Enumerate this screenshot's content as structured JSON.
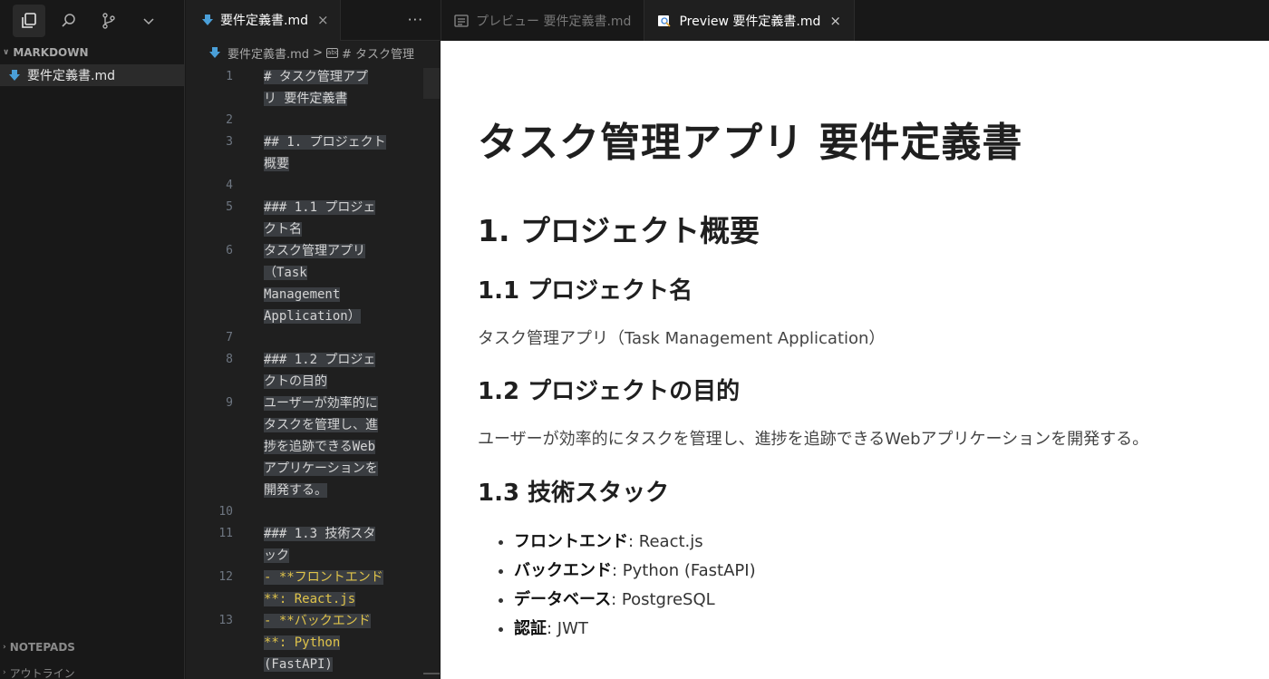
{
  "sidebar": {
    "section_title": "MARKDOWN",
    "file_name": "要件定義書.md",
    "notepads_label": "NOTEPADS",
    "outline_label": "アウトライン"
  },
  "editor": {
    "tab_label": "要件定義書.md",
    "close_glyph": "×",
    "more_glyph": "···",
    "breadcrumb_file": "要件定義書.md",
    "breadcrumb_sep": ">",
    "breadcrumb_icon": "abc",
    "breadcrumb_symbol": "# タスク管理",
    "lines": [
      {
        "n": "1",
        "rows": [
          "# タスク管理アプ",
          "リ 要件定義書"
        ]
      },
      {
        "n": "2",
        "rows": [
          ""
        ]
      },
      {
        "n": "3",
        "rows": [
          "## 1. プロジェクト",
          "概要"
        ]
      },
      {
        "n": "4",
        "rows": [
          ""
        ]
      },
      {
        "n": "5",
        "rows": [
          "### 1.1 プロジェ",
          "クト名"
        ]
      },
      {
        "n": "6",
        "rows": [
          "タスク管理アプリ",
          "（Task",
          "Management",
          "Application）"
        ]
      },
      {
        "n": "7",
        "rows": [
          ""
        ]
      },
      {
        "n": "8",
        "rows": [
          "### 1.2 プロジェ",
          "クトの目的"
        ]
      },
      {
        "n": "9",
        "rows": [
          "ユーザーが効率的に",
          "タスクを管理し、進",
          "捗を追跡できるWeb",
          "アプリケーションを",
          "開発する。"
        ]
      },
      {
        "n": "10",
        "rows": [
          ""
        ]
      },
      {
        "n": "11",
        "rows": [
          "### 1.3 技術スタ",
          "ック"
        ]
      },
      {
        "n": "12",
        "rows": [
          "- **フロントエンド",
          "**: React.js"
        ]
      },
      {
        "n": "13",
        "rows": [
          "- **バックエンド",
          "**: Python",
          "(FastAPI)"
        ]
      }
    ]
  },
  "preview_tabs": {
    "inactive_label": "プレビュー 要件定義書.md",
    "active_label": "Preview 要件定義書.md",
    "close_glyph": "×"
  },
  "preview": {
    "h1": "タスク管理アプリ 要件定義書",
    "h2": "1. プロジェクト概要",
    "h3_1": "1.1 プロジェクト名",
    "p_1": "タスク管理アプリ（Task Management Application）",
    "h3_2": "1.2 プロジェクトの目的",
    "p_2": "ユーザーが効率的にタスクを管理し、進捗を追跡できるWebアプリケーションを開発する。",
    "h3_3": "1.3 技術スタック",
    "stack": [
      {
        "label": "フロントエンド",
        "value": ": React.js"
      },
      {
        "label": "バックエンド",
        "value": ": Python (FastAPI)"
      },
      {
        "label": "データベース",
        "value": ": PostgreSQL"
      },
      {
        "label": "認証",
        "value": ": JWT"
      }
    ]
  },
  "colors": {
    "markdown_icon": "#4a9fd8",
    "bold_marker": "#e0c44a",
    "line_highlight": "#3a3d41"
  },
  "icons": [
    "explorer-icon",
    "search-icon",
    "source-control-icon",
    "chevron-down-icon",
    "markdown-file-icon",
    "preview-icon"
  ]
}
